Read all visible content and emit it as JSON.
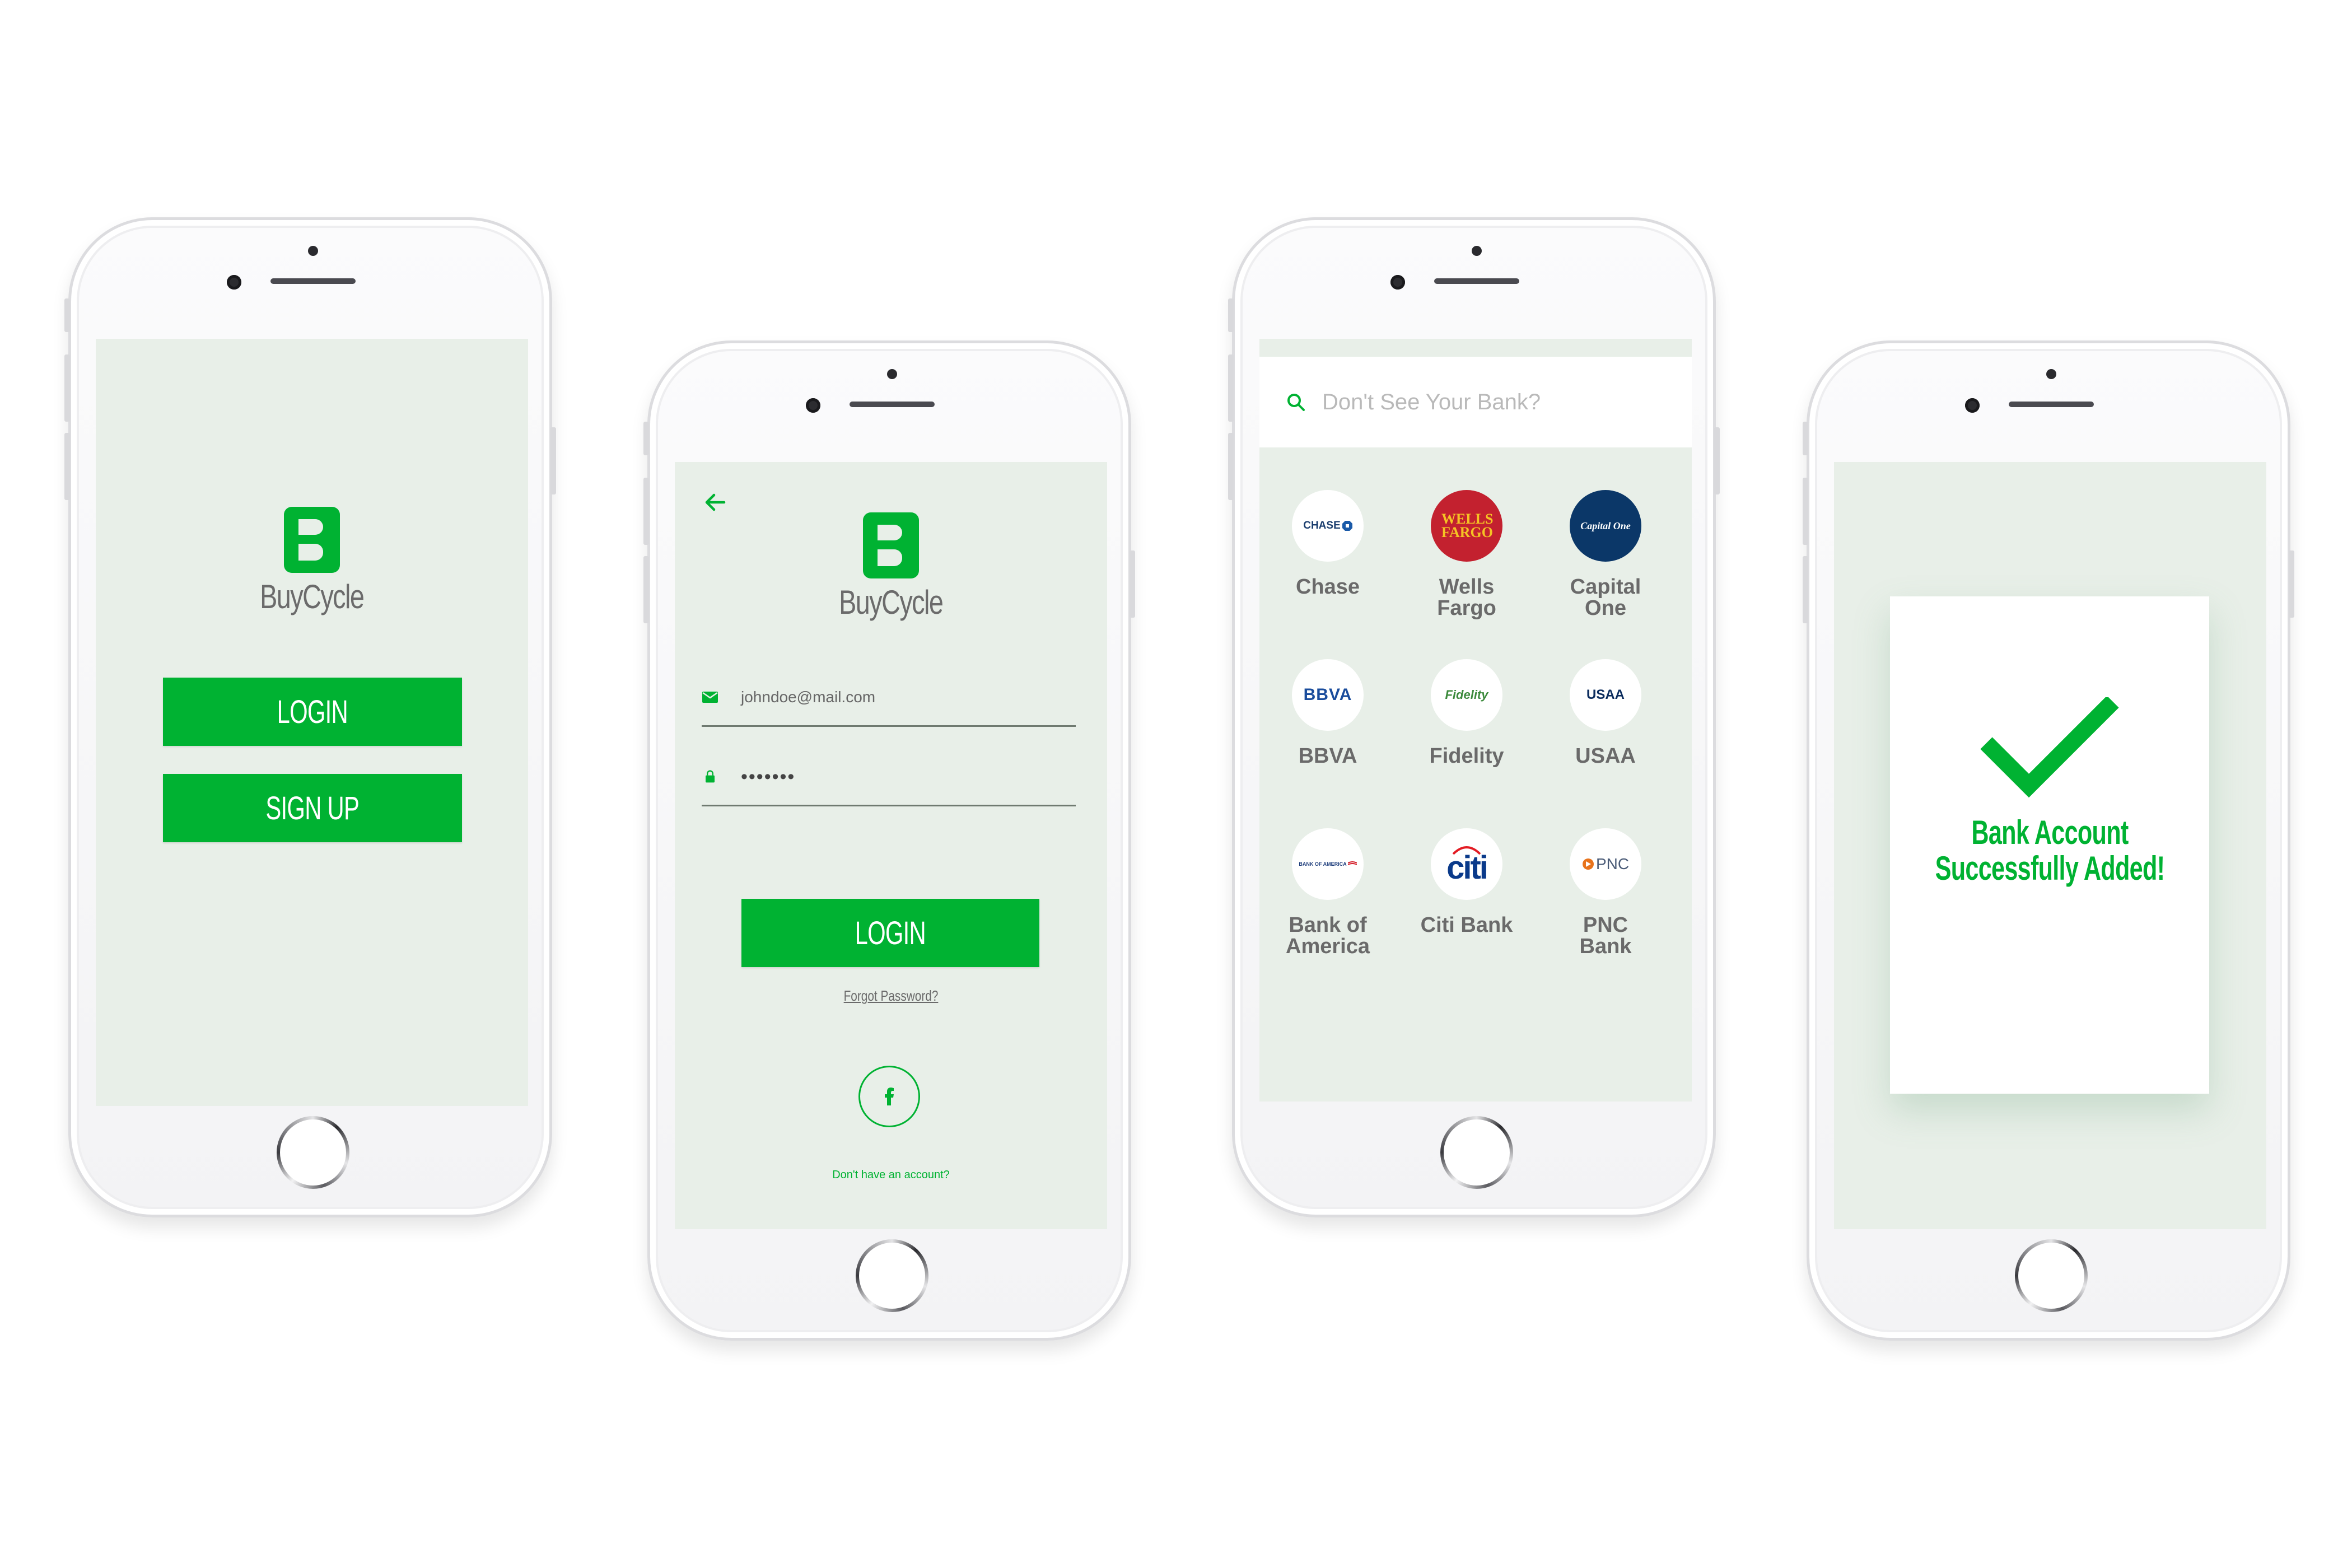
{
  "brand": {
    "name": "BuyCycle",
    "color": "#00b232",
    "screen_bg": "#e8efe8"
  },
  "welcome": {
    "login_label": "LOGIN",
    "signup_label": "SIGN UP"
  },
  "login": {
    "back_icon": "arrow-left-icon",
    "email_value": "johndoe@mail.com",
    "password_value": "•••••••",
    "login_label": "LOGIN",
    "forgot_label": "Forgot Password?",
    "facebook_icon": "facebook-icon",
    "signup_prompt": "Don't have an account?"
  },
  "bank_select": {
    "search_placeholder": "Don't See Your Bank?",
    "banks": [
      {
        "name": "Chase",
        "logo_text": "CHASE"
      },
      {
        "name": "Wells Fargo",
        "logo_text": "WELLS FARGO"
      },
      {
        "name": "Capital One",
        "logo_text": "Capital One"
      },
      {
        "name": "BBVA",
        "logo_text": "BBVA"
      },
      {
        "name": "Fidelity",
        "logo_text": "Fidelity"
      },
      {
        "name": "USAA",
        "logo_text": "USAA"
      },
      {
        "name": "Bank of America",
        "logo_text": "BANK OF AMERICA"
      },
      {
        "name": "Citi Bank",
        "logo_text": "citi"
      },
      {
        "name": "PNC Bank",
        "logo_text": "PNC"
      }
    ]
  },
  "success": {
    "message_line1": "Bank Account",
    "message_line2": "Successfully Added!",
    "icon": "checkmark-icon"
  }
}
